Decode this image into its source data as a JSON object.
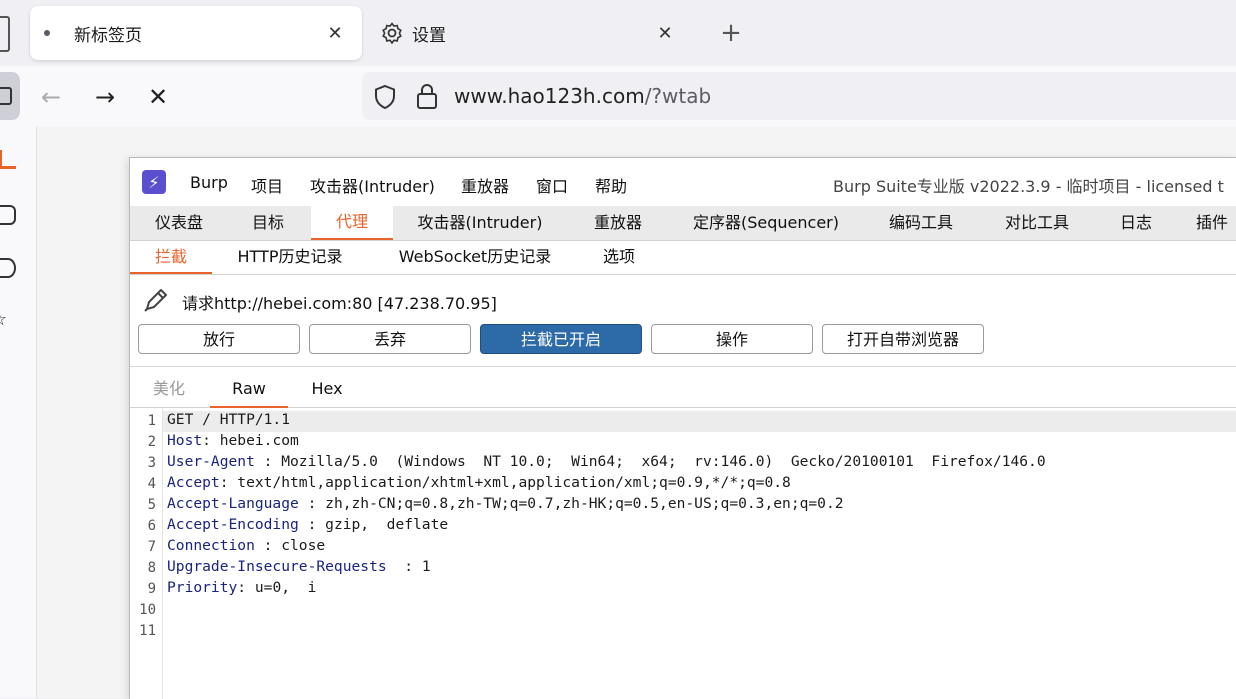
{
  "browser": {
    "tabs": [
      {
        "label": "新标签页",
        "active": true
      },
      {
        "label": "设置",
        "active": false
      }
    ],
    "url": {
      "host": "www.hao123h.com",
      "path": "/?wtab"
    }
  },
  "burp": {
    "menu": [
      "Burp",
      "项目",
      "攻击器(Intruder)",
      "重放器",
      "窗口",
      "帮助"
    ],
    "window_title": "Burp Suite专业版  v2022.3.9 - 临时项目 - licensed t",
    "main_tabs": [
      "仪表盘",
      "目标",
      "代理",
      "攻击器(Intruder)",
      "重放器",
      "定序器(Sequencer)",
      "编码工具",
      "对比工具",
      "日志",
      "插件"
    ],
    "proxy_tabs": [
      "拦截",
      "HTTP历史记录",
      "WebSocket历史记录",
      "选项"
    ],
    "request_line": "请求http://hebei.com:80  [47.238.70.95]",
    "buttons": [
      "放行",
      "丢弃",
      "拦截已开启",
      "操作",
      "打开自带浏览器"
    ],
    "view_tabs": [
      "美化",
      "Raw",
      "Hex"
    ],
    "request_lines": [
      {
        "num": "1",
        "name": "",
        "value": "GET / HTTP/1.1"
      },
      {
        "num": "2",
        "name": "Host",
        "sep": ": ",
        "value": "hebei.com"
      },
      {
        "num": "3",
        "name": "User-Agent",
        "sep": " : ",
        "value": "Mozilla/5.0  (Windows  NT 10.0;  Win64;  x64;  rv:146.0)  Gecko/20100101  Firefox/146.0"
      },
      {
        "num": "4",
        "name": "Accept",
        "sep": ": ",
        "value": "text/html,application/xhtml+xml,application/xml;q=0.9,*/*;q=0.8"
      },
      {
        "num": "5",
        "name": "Accept-Language",
        "sep": " : ",
        "value": "zh,zh-CN;q=0.8,zh-TW;q=0.7,zh-HK;q=0.5,en-US;q=0.3,en;q=0.2"
      },
      {
        "num": "6",
        "name": "Accept-Encoding",
        "sep": " : ",
        "value": "gzip,  deflate"
      },
      {
        "num": "7",
        "name": "Connection",
        "sep": " : ",
        "value": "close"
      },
      {
        "num": "8",
        "name": "Upgrade-Insecure-Requests",
        "sep": "  : ",
        "value": "1"
      },
      {
        "num": "9",
        "name": "Priority",
        "sep": ": ",
        "value": "u=0,  i"
      },
      {
        "num": "10",
        "name": "",
        "value": ""
      },
      {
        "num": "11",
        "name": "",
        "value": ""
      }
    ]
  },
  "colors": {
    "accent": "#e8642c",
    "primary_button": "#2d6aa8",
    "header_name": "#1a237e"
  },
  "icons": [
    "close-icon",
    "gear-icon",
    "plus-icon",
    "back-arrow-icon",
    "forward-arrow-icon",
    "stop-icon",
    "shield-icon",
    "lock-icon",
    "pencil-icon",
    "burp-logo-icon"
  ]
}
